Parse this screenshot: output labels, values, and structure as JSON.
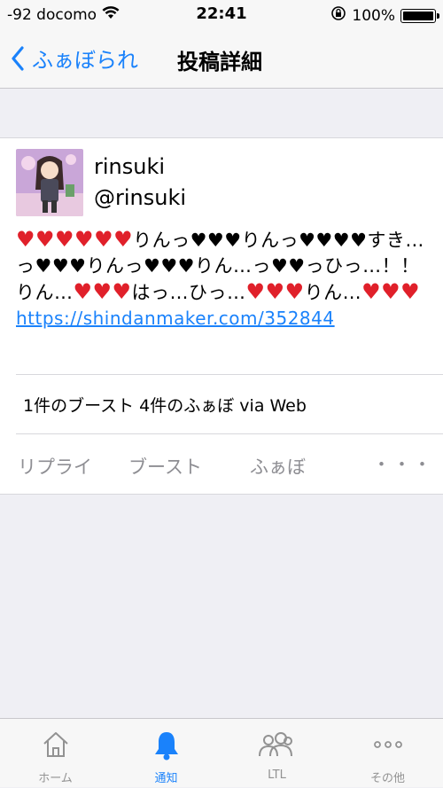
{
  "status_bar": {
    "carrier": "-92 docomo",
    "time": "22:41",
    "battery": "100%",
    "battery_level": 1.0
  },
  "nav": {
    "back_label": "ふぁぼられ",
    "title": "投稿詳細"
  },
  "post": {
    "display_name": "rinsuki",
    "handle": "@rinsuki",
    "body_text": "❤️❤️❤️❤️❤️❤️りんっ♥♥♥りんっ♥♥♥♥すき…っ♥♥♥りんっ♥♥♥りん…っ♥♥っひっ…！！りん…❤️❤️❤️はっ…ひっ…❤️❤️❤️りん…❤️❤️❤️",
    "link": "https://shindanmaker.com/352844",
    "stats": "1件のブースト 4件のふぁぼ via Web",
    "actions": {
      "reply": "リプライ",
      "boost": "ブースト",
      "fav": "ふぁぼ",
      "more": "・・・"
    }
  },
  "tabs": [
    {
      "label": "ホーム",
      "icon": "home-icon"
    },
    {
      "label": "通知",
      "icon": "bell-icon",
      "active": true
    },
    {
      "label": "LTL",
      "icon": "people-icon"
    },
    {
      "label": "その他",
      "icon": "more-icon"
    }
  ],
  "colors": {
    "accent": "#1a82fb",
    "heart_red": "#e0202a",
    "inactive": "#929292"
  }
}
